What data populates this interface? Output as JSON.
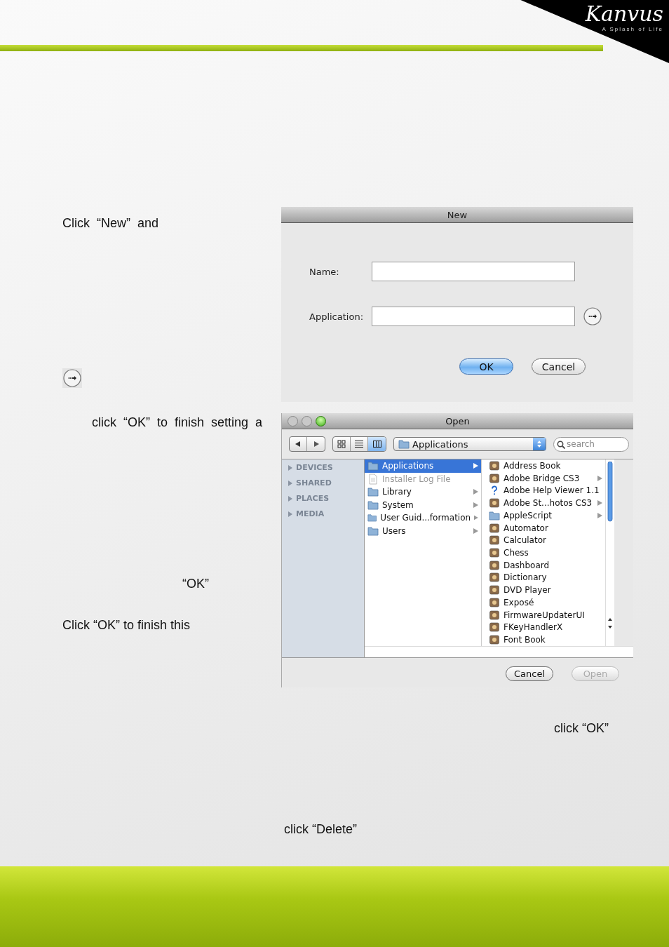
{
  "header": {
    "logo": "Kanvus",
    "tagline": "A Splash of Life"
  },
  "notes": [
    {
      "kind": "text",
      "text": "Click  “New”  and"
    },
    {
      "kind": "browse_icon"
    },
    {
      "kind": "text",
      "text": "click  “OK”  to  finish  setting  a"
    },
    {
      "kind": "text",
      "text": "“OK”"
    },
    {
      "kind": "text",
      "text": "Click “OK” to finish this"
    }
  ],
  "new_dialog": {
    "title": "New",
    "fields": [
      {
        "label": "Name:",
        "has_browse": false
      },
      {
        "label": "Application:",
        "has_browse": true
      }
    ],
    "buttons": [
      {
        "label": "OK",
        "default": true
      },
      {
        "label": "Cancel",
        "default": false
      }
    ]
  },
  "open_dialog": {
    "title": "Open",
    "view_buttons": [
      {
        "kind": "icons",
        "selected": false
      },
      {
        "kind": "list",
        "selected": false
      },
      {
        "kind": "columns",
        "selected": true
      }
    ],
    "location": "Applications",
    "search": {
      "placeholder": "search"
    },
    "sidebar": [
      {
        "label": "DEVICES",
        "expanded": false
      },
      {
        "label": "SHARED",
        "expanded": false
      },
      {
        "label": "PLACES",
        "expanded": false
      },
      {
        "label": "MEDIA",
        "expanded": false
      }
    ],
    "columns": [
      {
        "items": [
          {
            "label": "Applications",
            "kind": "folder",
            "selected": true,
            "disabled": false,
            "has_children": true
          },
          {
            "label": "Installer Log File",
            "kind": "document",
            "selected": false,
            "disabled": true,
            "has_children": false
          },
          {
            "label": "Library",
            "kind": "folder",
            "selected": false,
            "disabled": false,
            "has_children": true
          },
          {
            "label": "System",
            "kind": "folder",
            "selected": false,
            "disabled": false,
            "has_children": true
          },
          {
            "label": "User Guid...formation",
            "kind": "folder",
            "selected": false,
            "disabled": false,
            "has_children": true
          },
          {
            "label": "Users",
            "kind": "folder",
            "selected": false,
            "disabled": false,
            "has_children": true
          }
        ]
      },
      {
        "items": [
          {
            "label": "Address Book",
            "kind": "app",
            "selected": false,
            "disabled": false,
            "has_children": false
          },
          {
            "label": "Adobe Bridge CS3",
            "kind": "app",
            "selected": false,
            "disabled": false,
            "has_children": true
          },
          {
            "label": "Adobe Help Viewer 1.1",
            "kind": "help",
            "selected": false,
            "disabled": false,
            "has_children": false
          },
          {
            "label": "Adobe St...hotos CS3",
            "kind": "app",
            "selected": false,
            "disabled": false,
            "has_children": true
          },
          {
            "label": "AppleScript",
            "kind": "folder",
            "selected": false,
            "disabled": false,
            "has_children": true
          },
          {
            "label": "Automator",
            "kind": "app",
            "selected": false,
            "disabled": false,
            "has_children": false
          },
          {
            "label": "Calculator",
            "kind": "app",
            "selected": false,
            "disabled": false,
            "has_children": false
          },
          {
            "label": "Chess",
            "kind": "app",
            "selected": false,
            "disabled": false,
            "has_children": false
          },
          {
            "label": "Dashboard",
            "kind": "app",
            "selected": false,
            "disabled": false,
            "has_children": false
          },
          {
            "label": "Dictionary",
            "kind": "app",
            "selected": false,
            "disabled": false,
            "has_children": false
          },
          {
            "label": "DVD Player",
            "kind": "app",
            "selected": false,
            "disabled": false,
            "has_children": false
          },
          {
            "label": "Exposé",
            "kind": "app",
            "selected": false,
            "disabled": false,
            "has_children": false
          },
          {
            "label": "FirmwareUpdaterUI",
            "kind": "app",
            "selected": false,
            "disabled": false,
            "has_children": false
          },
          {
            "label": "FKeyHandlerX",
            "kind": "app",
            "selected": false,
            "disabled": false,
            "has_children": false
          },
          {
            "label": "Font Book",
            "kind": "app",
            "selected": false,
            "disabled": false,
            "has_children": false
          }
        ]
      }
    ],
    "buttons": [
      {
        "label": "Cancel",
        "disabled": false
      },
      {
        "label": "Open",
        "disabled": true
      }
    ]
  },
  "bottom_notes": [
    {
      "text": "click “OK”"
    },
    {
      "text": "click “Delete”"
    }
  ]
}
